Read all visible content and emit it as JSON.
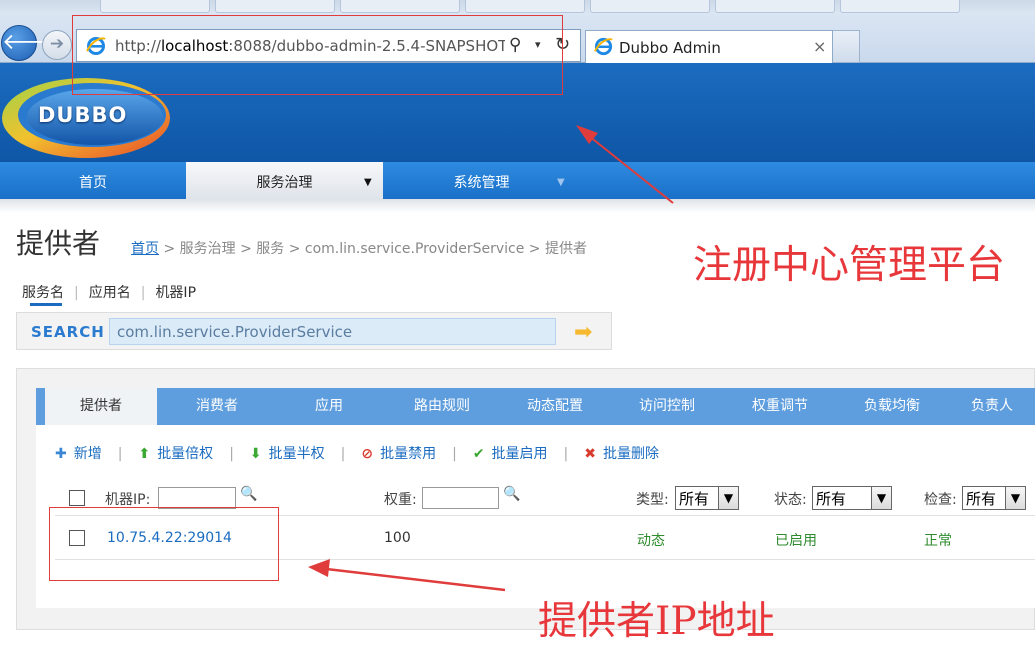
{
  "browser": {
    "url_prefix": "http://",
    "url_host": "localhost",
    "url_rest": ":8088/dubbo-admin-2.5.4-SNAPSHOT",
    "tab_title": "Dubbo Admin",
    "tab_close": "×",
    "back_glyph": "🡐",
    "forward_glyph": "➔",
    "search_glyph": "⚲",
    "dropdown_glyph": "▾",
    "refresh_glyph": "↻"
  },
  "header": {
    "logo_text": "DUBBO"
  },
  "mainnav": {
    "items": [
      {
        "label": "首页"
      },
      {
        "label": "服务治理",
        "arrow": "▼"
      },
      {
        "label": "系统管理",
        "arrow": "▼"
      }
    ]
  },
  "page": {
    "title": "提供者",
    "breadcrumb": {
      "home": "首页",
      "rest": " > 服务治理 > 服务 > com.lin.service.ProviderService > 提供者"
    }
  },
  "search": {
    "tabs": [
      "服务名",
      "应用名",
      "机器IP"
    ],
    "separator": "|",
    "label": "SEARCH",
    "value": "com.lin.service.ProviderService",
    "go_glyph": "➡"
  },
  "subtabs": [
    "提供者",
    "消费者",
    "应用",
    "路由规则",
    "动态配置",
    "访问控制",
    "权重调节",
    "负载均衡",
    "负责人"
  ],
  "actions": {
    "separator": "|",
    "items": [
      {
        "label": "新增",
        "icon": "plus-icon",
        "glyph": "✚",
        "color": "#3a86d4"
      },
      {
        "label": "批量倍权",
        "icon": "arrow-up-icon",
        "glyph": "⬆",
        "color": "#3aa832"
      },
      {
        "label": "批量半权",
        "icon": "arrow-down-icon",
        "glyph": "⬇",
        "color": "#3aa832"
      },
      {
        "label": "批量禁用",
        "icon": "forbidden-icon",
        "glyph": "⊘",
        "color": "#d83a2e"
      },
      {
        "label": "批量启用",
        "icon": "check-icon",
        "glyph": "✔",
        "color": "#3aa832"
      },
      {
        "label": "批量删除",
        "icon": "cross-icon",
        "glyph": "✖",
        "color": "#d83a2e"
      }
    ]
  },
  "table": {
    "headers": {
      "ip": "机器IP:",
      "weight": "权重:",
      "type": "类型:",
      "status": "状态:",
      "check": "检查:"
    },
    "search_glyph": "🔍",
    "selects": {
      "type": "所有",
      "status": "所有",
      "check": "所有",
      "arrow": "▼"
    },
    "rows": [
      {
        "ip": "10.75.4.22:29014",
        "weight": "100",
        "type": "动态",
        "status": "已启用",
        "check": "正常"
      }
    ]
  },
  "annotations": {
    "registry_note": "注册中心管理平台",
    "ip_note": "提供者IP地址",
    "color": "#e8373a"
  }
}
